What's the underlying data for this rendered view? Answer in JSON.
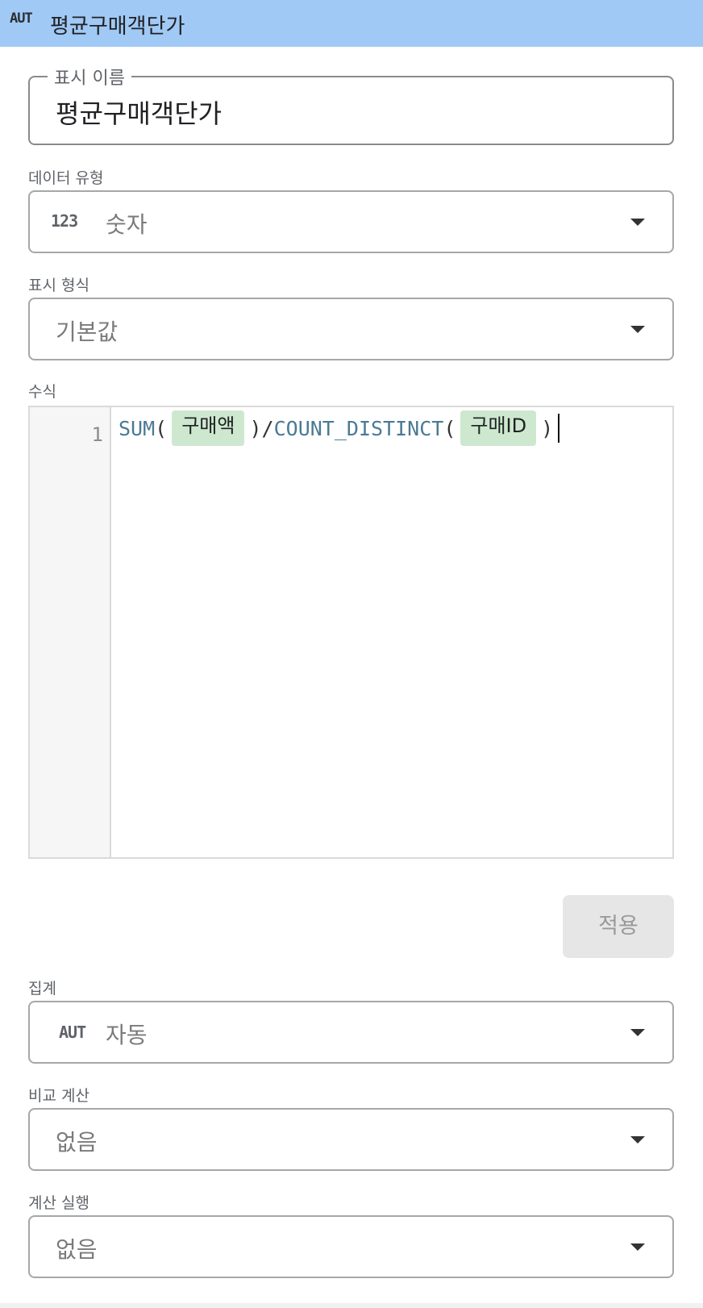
{
  "header": {
    "type_badge": "AUT",
    "title": "평균구매객단가"
  },
  "display_name": {
    "label": "표시 이름",
    "value": "평균구매객단가"
  },
  "data_type": {
    "label": "데이터 유형",
    "icon_text": "123",
    "value": "숫자"
  },
  "display_format": {
    "label": "표시 형식",
    "value": "기본값"
  },
  "formula": {
    "label": "수식",
    "line_number": "1",
    "tokens": {
      "fn1": "SUM",
      "open1": "(",
      "chip1": "구매액",
      "close1": ")",
      "slash": "/",
      "fn2": "COUNT_DISTINCT",
      "open2": "(",
      "chip2": "구매ID",
      "close2": ")"
    }
  },
  "apply_button": {
    "label": "적용"
  },
  "aggregation": {
    "label": "집계",
    "icon_text": "AUT",
    "value": "자동"
  },
  "comparison": {
    "label": "비교 계산",
    "value": "없음"
  },
  "running_calc": {
    "label": "계산 실행",
    "value": "없음"
  }
}
